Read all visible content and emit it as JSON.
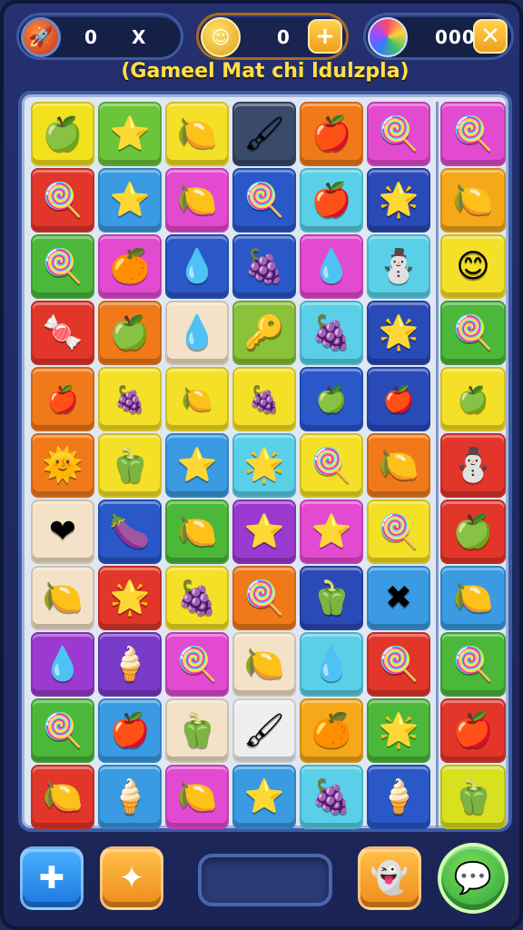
{
  "hud": {
    "lives": {
      "icon": "rocket-badge-icon",
      "value1": "0",
      "value2": "X"
    },
    "coins": {
      "icon": "coin-icon",
      "value": "0",
      "plus_label": "+"
    },
    "gems": {
      "icon": "gem-icon",
      "value": "000",
      "close_label": "✕"
    }
  },
  "title": "(Gameel Mat chi ldulzpla)",
  "board": {
    "rows": [
      [
        {
          "c": "#f2e21e",
          "g": "🍏",
          "n": "green-apple-icon"
        },
        {
          "c": "#6cc43a",
          "g": "⭐",
          "n": "star-face-icon"
        },
        {
          "c": "#f5e028",
          "g": "🍋",
          "n": "lemon-icon"
        },
        {
          "c": "#3a4a6a",
          "g": "🖌",
          "n": "brush-icon"
        },
        {
          "c": "#f07a1a",
          "g": "🍎",
          "n": "red-apple-icon"
        },
        {
          "c": "#e24ad0",
          "g": "🍭",
          "n": "blue-lollipop-icon"
        }
      ],
      [
        {
          "c": "#e2362a",
          "g": "🍭",
          "n": "blue-lollipop-icon"
        },
        {
          "c": "#3a9ae2",
          "g": "⭐",
          "n": "blue-star-icon"
        },
        {
          "c": "#e24ad0",
          "g": "🍋",
          "n": "lemon-icon"
        },
        {
          "c": "#2a58c8",
          "g": "🍭",
          "n": "blue-lollipop-icon"
        },
        {
          "c": "#5ad0e8",
          "g": "🍎",
          "n": "red-apple-icon"
        },
        {
          "c": "#2a4ab8",
          "g": "🌟",
          "n": "sun-face-icon"
        }
      ],
      [
        {
          "c": "#4cb83a",
          "g": "🍭",
          "n": "blue-lollipop-icon"
        },
        {
          "c": "#e24ad0",
          "g": "🍊",
          "n": "orange-fruit-icon"
        },
        {
          "c": "#2a58c8",
          "g": "💧",
          "n": "blue-drop-icon"
        },
        {
          "c": "#2a58c8",
          "g": "🍇",
          "n": "purple-grape-icon"
        },
        {
          "c": "#e24ad0",
          "g": "💧",
          "n": "blue-drop-icon"
        },
        {
          "c": "#5ad0e8",
          "g": "⛄",
          "n": "snowman-icon"
        }
      ],
      [
        {
          "c": "#e2362a",
          "g": "🍬",
          "n": "white-candy-icon"
        },
        {
          "c": "#f07a1a",
          "g": "🍏",
          "n": "green-apple-icon"
        },
        {
          "c": "#f3e2c8",
          "g": "💧",
          "n": "blue-drop-icon"
        },
        {
          "c": "#8ac23a",
          "g": "🔑",
          "n": "key-icon"
        },
        {
          "c": "#5ad0e8",
          "g": "🍇",
          "n": "purple-grape-icon"
        },
        {
          "c": "#2a4ab8",
          "g": "🌟",
          "n": "sun-face-icon"
        }
      ],
      [
        {
          "c": "#f07a1a",
          "g": "🍎",
          "n": "red-apple-icon",
          "thin": true
        },
        {
          "c": "#f5e028",
          "g": "🍇",
          "n": "purple-grape-icon",
          "thin": true
        },
        {
          "c": "#f5e028",
          "g": "🍋",
          "n": "lemon-icon",
          "thin": true
        },
        {
          "c": "#f5e028",
          "g": "🍇",
          "n": "purple-grape-icon",
          "thin": true
        },
        {
          "c": "#2a58c8",
          "g": "🍏",
          "n": "green-apple-icon",
          "thin": true
        },
        {
          "c": "#2a4ab8",
          "g": "🍎",
          "n": "red-apple-icon",
          "thin": true
        }
      ],
      [
        {
          "c": "#f07a1a",
          "g": "🌞",
          "n": "sun-face-icon"
        },
        {
          "c": "#f5e028",
          "g": "🫑",
          "n": "green-pepper-icon"
        },
        {
          "c": "#3a9ae2",
          "g": "⭐",
          "n": "blue-star-icon"
        },
        {
          "c": "#5ad0e8",
          "g": "🌟",
          "n": "sun-face-icon"
        },
        {
          "c": "#f5e028",
          "g": "🍭",
          "n": "blue-lollipop-icon"
        },
        {
          "c": "#f07a1a",
          "g": "🍋",
          "n": "lemon-icon"
        }
      ],
      [
        {
          "c": "#f3e2c8",
          "g": "❤",
          "n": "heart-icon"
        },
        {
          "c": "#2a58c8",
          "g": "🍆",
          "n": "eggplant-icon"
        },
        {
          "c": "#4cb83a",
          "g": "🍋",
          "n": "lemon-icon"
        },
        {
          "c": "#9a3ad0",
          "g": "⭐",
          "n": "yellow-star-icon"
        },
        {
          "c": "#e24ad0",
          "g": "⭐",
          "n": "yellow-star-icon"
        },
        {
          "c": "#f5e028",
          "g": "🍭",
          "n": "blue-lollipop-icon"
        }
      ],
      [
        {
          "c": "#f3e2c8",
          "g": "🍋",
          "n": "lemon-icon"
        },
        {
          "c": "#e2362a",
          "g": "🌟",
          "n": "star-face-icon"
        },
        {
          "c": "#f5e028",
          "g": "🍇",
          "n": "purple-grape-icon"
        },
        {
          "c": "#f07a1a",
          "g": "🍭",
          "n": "pink-lollipop-icon"
        },
        {
          "c": "#2a4ab8",
          "g": "🫑",
          "n": "green-pepper-icon"
        },
        {
          "c": "#3a9ae2",
          "g": "✖",
          "n": "green-x-icon"
        }
      ],
      [
        {
          "c": "#9a3ad0",
          "g": "💧",
          "n": "blue-drop-icon"
        },
        {
          "c": "#7a3ac8",
          "g": "🍦",
          "n": "ice-cream-icon"
        },
        {
          "c": "#e24ad0",
          "g": "🍭",
          "n": "blue-lollipop-icon"
        },
        {
          "c": "#f3e2c8",
          "g": "🍋",
          "n": "lemon-icon"
        },
        {
          "c": "#5ad0e8",
          "g": "💧",
          "n": "blue-drop-icon"
        },
        {
          "c": "#e2362a",
          "g": "🍭",
          "n": "purple-lollipop-icon"
        }
      ],
      [
        {
          "c": "#4cb83a",
          "g": "🍭",
          "n": "blue-lollipop-icon"
        },
        {
          "c": "#3a9ae2",
          "g": "🍎",
          "n": "red-apple-icon"
        },
        {
          "c": "#f3e2c8",
          "g": "🫑",
          "n": "green-pepper-icon"
        },
        {
          "c": "#eeeeee",
          "g": "🖌",
          "n": "brush-icon"
        },
        {
          "c": "#f5a81a",
          "g": "🍊",
          "n": "orange-fruit-icon"
        },
        {
          "c": "#4cb83a",
          "g": "🌟",
          "n": "star-face-icon"
        }
      ],
      [
        {
          "c": "#e2362a",
          "g": "🍋",
          "n": "lemon-icon"
        },
        {
          "c": "#3a9ae2",
          "g": "🍦",
          "n": "ice-cream-icon"
        },
        {
          "c": "#e24ad0",
          "g": "🍋",
          "n": "lemon-icon"
        },
        {
          "c": "#3a9ae2",
          "g": "⭐",
          "n": "yellow-star-icon"
        },
        {
          "c": "#5ad0e8",
          "g": "🍇",
          "n": "purple-grape-icon"
        },
        {
          "c": "#2a58c8",
          "g": "🍦",
          "n": "ice-cream-icon"
        }
      ]
    ],
    "side": [
      {
        "c": "#e24ad0",
        "g": "🍭",
        "n": "purple-lollipop-icon"
      },
      {
        "c": "#f5a81a",
        "g": "🍋",
        "n": "lemon-icon"
      },
      {
        "c": "#f5e028",
        "g": "😊",
        "n": "smiley-face-icon"
      },
      {
        "c": "#4cb83a",
        "g": "🍭",
        "n": "blue-lollipop-icon"
      },
      {
        "c": "#f5e028",
        "g": "🍏",
        "n": "green-apple-icon",
        "thin": true
      },
      {
        "c": "#e2362a",
        "g": "⛄",
        "n": "snowman-icon"
      },
      {
        "c": "#e2362a",
        "g": "🍏",
        "n": "green-apple-icon"
      },
      {
        "c": "#3a9ae2",
        "g": "🍋",
        "n": "lemon-icon"
      },
      {
        "c": "#4cb83a",
        "g": "🍭",
        "n": "blue-lollipop-icon"
      },
      {
        "c": "#e2362a",
        "g": "🍎",
        "n": "red-apple-icon"
      },
      {
        "c": "#d8e020",
        "g": "🫑",
        "n": "green-pepper-icon"
      }
    ]
  },
  "controls": {
    "b1": {
      "icon": "puzzle-piece-icon",
      "glyph": "✚"
    },
    "b2": {
      "icon": "bandage-icon",
      "glyph": "✦"
    },
    "b3": {
      "icon": "ghost-icon",
      "glyph": "👻"
    },
    "b4": {
      "icon": "chat-bubble-icon",
      "glyph": "💬"
    }
  }
}
